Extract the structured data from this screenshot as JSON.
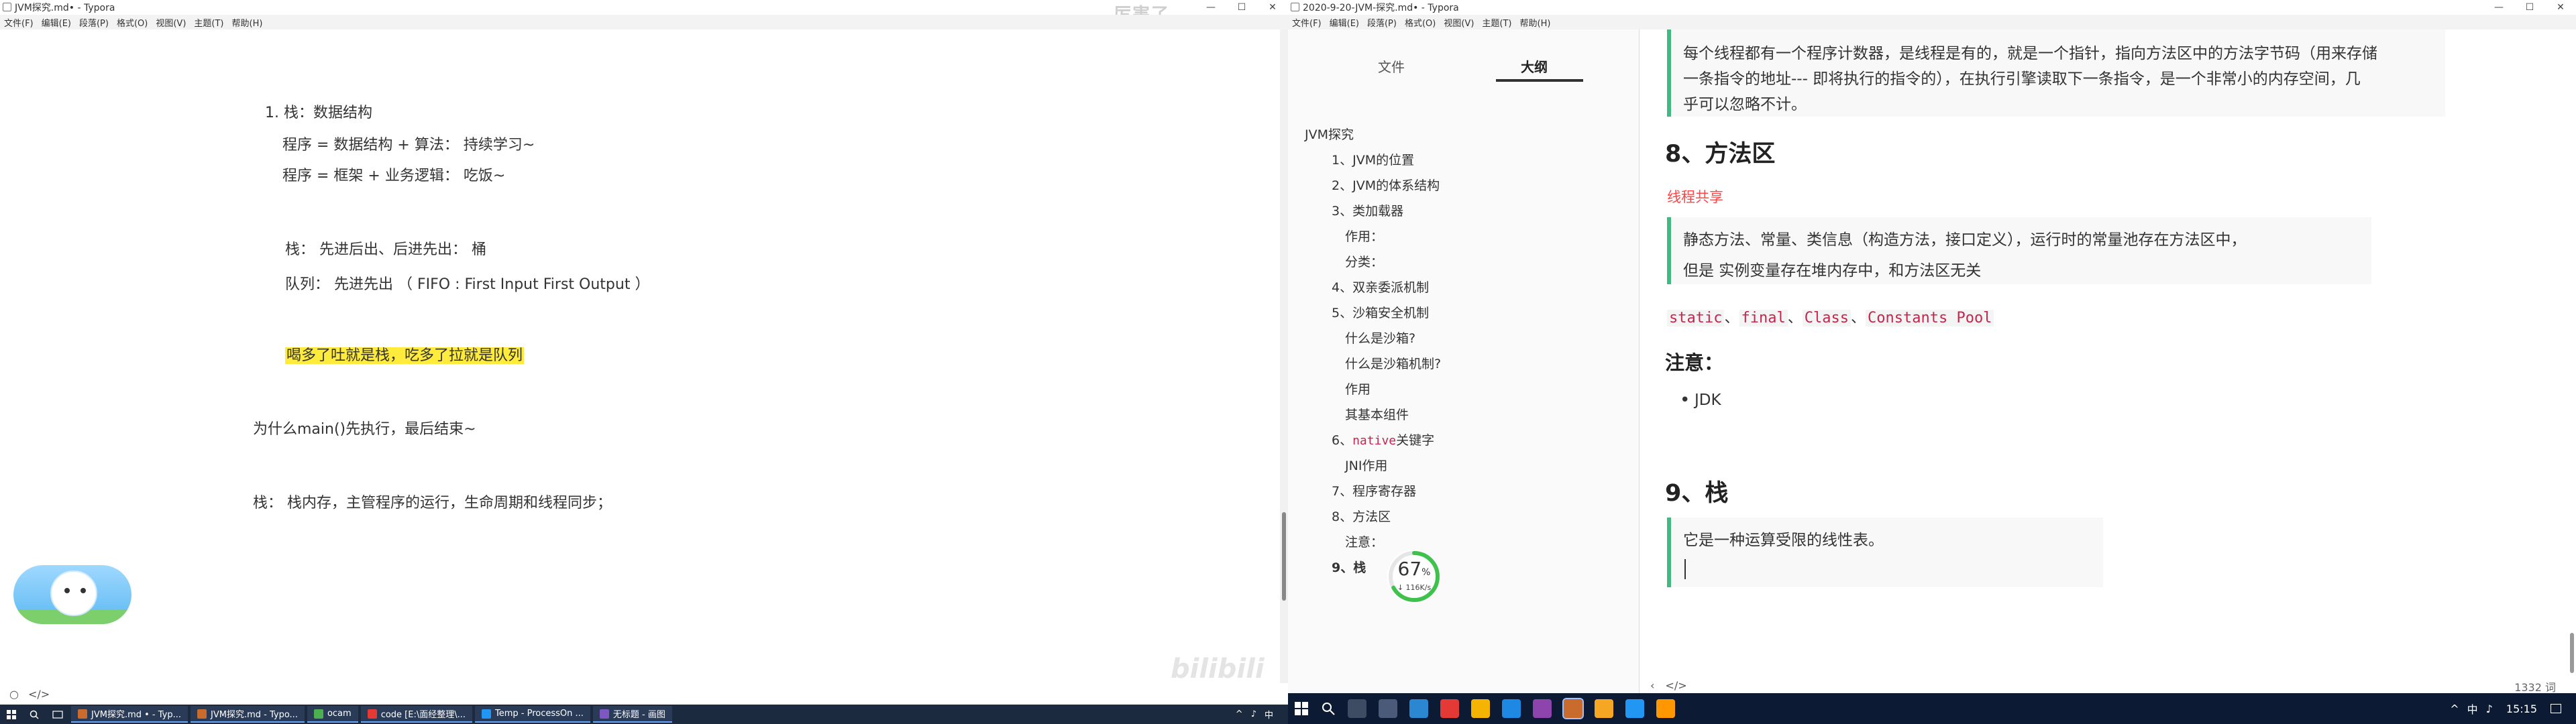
{
  "left_window": {
    "title": "JVM探究.md• - Typora",
    "menu": [
      "文件(F)",
      "编辑(E)",
      "段落(P)",
      "格式(O)",
      "视图(V)",
      "主题(T)",
      "帮助(H)"
    ],
    "window_controls": [
      "—",
      "☐",
      "✕"
    ],
    "danmu": "厉害了",
    "lines": [
      "1.  栈：数据结构",
      "程序 = 数据结构 + 算法：  持续学习~",
      "程序 = 框架 + 业务逻辑：  吃饭~",
      "栈：  先进后出、后进先出：  桶",
      "队列：  先进先出   （ FIFO : First Input First Output ）",
      "喝多了吐就是栈，吃多了拉就是队列",
      "为什么main()先执行，最后结束~",
      "栈：  栈内存，主管程序的运行，生命周期和线程同步；"
    ],
    "footer_icons": [
      "○",
      "</>"
    ],
    "watermark": "bilibili"
  },
  "right_window": {
    "title": "2020-9-20-JVM-探究.md• - Typora",
    "menu": [
      "文件(F)",
      "编辑(E)",
      "段落(P)",
      "格式(O)",
      "视图(V)",
      "主题(T)",
      "帮助(H)"
    ],
    "window_controls": [
      "—",
      "☐",
      "✕"
    ],
    "sidebar": {
      "tabs": [
        "文件",
        "大纲"
      ],
      "active_tab": "大纲",
      "outline": [
        "JVM探究",
        "1、JVM的位置",
        "2、JVM的体系结构",
        "3、类加载器",
        "作用：",
        "分类：",
        "4、双亲委派机制",
        "5、沙箱安全机制",
        "什么是沙箱?",
        "什么是沙箱机制?",
        "作用",
        "其基本组件",
        "6、",
        "native",
        "关键字",
        "JNI作用",
        "7、程序寄存器",
        "8、方法区",
        "注意：",
        "9、栈"
      ],
      "speed_widget": {
        "percent": "67",
        "unit": "%",
        "rate": "↓ 116K/s",
        "value": 0.67
      }
    },
    "content": {
      "bq1_line1": "每个线程都有一个程序计数器，是线程是有的，就是一个指针，指向方法区中的方法字节码（用来存储",
      "bq1_line2": "一条指令的地址--- 即将执行的指令的），在执行引擎读取下一条指令，是一个非常小的内存空间，几",
      "bq1_line3": "乎可以忽略不计。",
      "h_method_area": "8、方法区",
      "thread_shared": "线程共享",
      "bq2_line1": "静态方法、常量、类信息（构造方法，接口定义），运行时的常量池存在方法区中，",
      "bq2_line2": "但是 实例变量存在堆内存中，和方法区无关",
      "code_items": [
        "static",
        "final",
        "Class",
        "Constants Pool"
      ],
      "code_sep": [
        "、",
        "、",
        "、"
      ],
      "h_note": "注意：",
      "bullet_jdk": "JDK",
      "h_stack": "9、栈",
      "bq3_line1": "它是一种运算受限的线性表。"
    },
    "footer_icons": [
      "‹",
      "</>"
    ],
    "word_count": "1332 词"
  },
  "taskbar_left": {
    "tasks": [
      "JVM探究.md • - Typ...",
      "JVM探究.md - Typo...",
      "ocam",
      "code [E:\\面经整理\\...",
      "Temp - ProcessOn ...",
      "无标题 - 画图"
    ],
    "tray": [
      "^",
      "♪",
      "中"
    ]
  },
  "taskbar_right": {
    "tray": [
      "^",
      "中",
      "♪"
    ],
    "clock": "15:15"
  },
  "colors": {
    "accent_green": "#42b983",
    "highlight_yellow": "#ffeb3b",
    "code_red": "#c7254e",
    "thread_red": "#ff4545"
  }
}
